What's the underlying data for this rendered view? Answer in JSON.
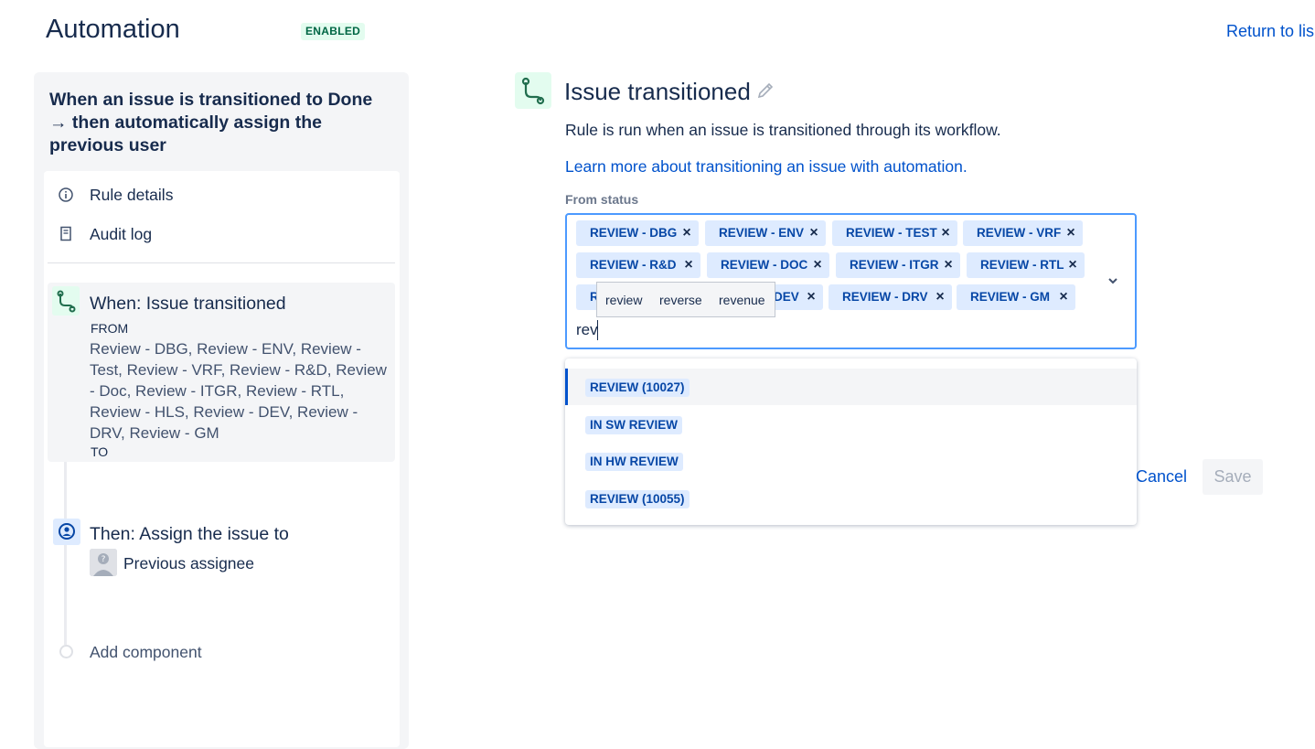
{
  "header": {
    "title": "Automation",
    "status_badge": "ENABLED",
    "return_link": "Return to lis"
  },
  "sidebar": {
    "rule_name": "When an issue is transitioned to Done → then automatically assign the previous user",
    "menu": [
      {
        "label": "Rule details",
        "icon": "info-icon"
      },
      {
        "label": "Audit log",
        "icon": "document-icon"
      }
    ],
    "trigger": {
      "title": "When: Issue transitioned",
      "from_label": "FROM",
      "from_values": "Review - DBG, Review - ENV, Review - Test, Review - VRF, Review - R&D, Review - Doc, Review - ITGR, Review - RTL, Review - HLS, Review - DEV, Review - DRV, Review - GM",
      "to_label": "TO"
    },
    "action": {
      "title": "Then: Assign the issue to",
      "assignee": "Previous assignee"
    },
    "add_component": "Add component"
  },
  "editor": {
    "title": "Issue transitioned",
    "description": "Rule is run when an issue is transitioned through its workflow.",
    "learn_more": "Learn more about transitioning an issue with automation.",
    "from_status_label": "From status",
    "selected_tags": [
      "REVIEW - DBG",
      "REVIEW - ENV",
      "REVIEW - TEST",
      "REVIEW - VRF",
      "REVIEW - R&D",
      "REVIEW - DOC",
      "REVIEW - ITGR",
      "REVIEW - RTL",
      "R",
      "DEV",
      "REVIEW - DRV",
      "REVIEW - GM"
    ],
    "input_value": "rev",
    "spell_suggestions": [
      "review",
      "reverse",
      "revenue"
    ],
    "options": [
      "REVIEW (10027)",
      "IN SW REVIEW",
      "IN HW REVIEW",
      "REVIEW (10055)"
    ],
    "cancel": "Cancel",
    "save": "Save"
  }
}
